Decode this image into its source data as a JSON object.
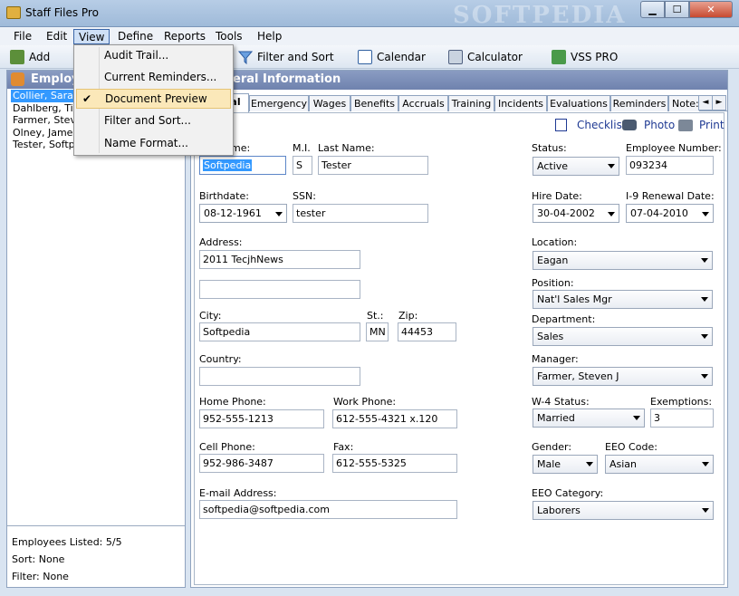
{
  "window": {
    "title": "Staff Files Pro",
    "watermark": "SOFTPEDIA",
    "min": "▁",
    "max": "☐",
    "close": "✕"
  },
  "menubar": [
    "File",
    "Edit",
    "View",
    "Define",
    "Reports",
    "Tools",
    "Help"
  ],
  "toolbar": {
    "add": "Add",
    "filter_sort": "Filter and Sort",
    "calendar": "Calendar",
    "calculator": "Calculator",
    "vss_pro": "VSS PRO"
  },
  "view_menu": {
    "items": [
      "Audit Trail...",
      "Current Reminders...",
      "Document Preview",
      "Filter and Sort...",
      "Name Format..."
    ],
    "checked": "✔"
  },
  "left_panel": {
    "header": "Employ",
    "employees": [
      "Collier, Sarah S",
      "Dahlberg, Tian",
      "Farmer, Steve",
      "Olney, James",
      "Tester, Softpe"
    ],
    "footer": {
      "listed": "Employees Listed: 5/5",
      "sort": "Sort: None",
      "filter": "Filter: None"
    }
  },
  "right_panel": {
    "header": "eral Information",
    "tabs": [
      "al",
      "Emergency",
      "Wages",
      "Benefits",
      "Accruals",
      "Training",
      "Incidents",
      "Evaluations",
      "Reminders",
      "Note:"
    ],
    "actions": {
      "checklist": "Checklist",
      "photo": "Photo",
      "print": "Print"
    },
    "form": {
      "first_name_label": "me:",
      "first_name": "Softpedia",
      "mi_label": "M.I.",
      "mi": "S",
      "last_name_label": "Last Name:",
      "last_name": "Tester",
      "birthdate_label": "Birthdate:",
      "birthdate": "08-12-1961",
      "ssn_label": "SSN:",
      "ssn": "tester",
      "address_label": "Address:",
      "address1": "2011 TecjhNews",
      "address2": "",
      "city_label": "City:",
      "city": "Softpedia",
      "st_label": "St.:",
      "st": "MN",
      "zip_label": "Zip:",
      "zip": "44453",
      "country_label": "Country:",
      "country": "",
      "home_phone_label": "Home Phone:",
      "home_phone": "952-555-1213",
      "work_phone_label": "Work Phone:",
      "work_phone": "612-555-4321 x.120",
      "cell_phone_label": "Cell Phone:",
      "cell_phone": "952-986-3487",
      "fax_label": "Fax:",
      "fax": "612-555-5325",
      "email_label": "E-mail Address:",
      "email": "softpedia@softpedia.com",
      "status_label": "Status:",
      "status": "Active",
      "emp_number_label": "Employee Number:",
      "emp_number": "093234",
      "hire_date_label": "Hire Date:",
      "hire_date": "30-04-2002",
      "i9_label": "I-9 Renewal Date:",
      "i9_date": "07-04-2010",
      "location_label": "Location:",
      "location": "Eagan",
      "position_label": "Position:",
      "position": "Nat'l Sales Mgr",
      "department_label": "Department:",
      "department": "Sales",
      "manager_label": "Manager:",
      "manager": "Farmer, Steven J",
      "w4_label": "W-4 Status:",
      "w4": "Married",
      "exemptions_label": "Exemptions:",
      "exemptions": "3",
      "gender_label": "Gender:",
      "gender": "Male",
      "eeo_code_label": "EEO Code:",
      "eeo_code": "Asian",
      "eeo_cat_label": "EEO Category:",
      "eeo_cat": "Laborers"
    }
  }
}
